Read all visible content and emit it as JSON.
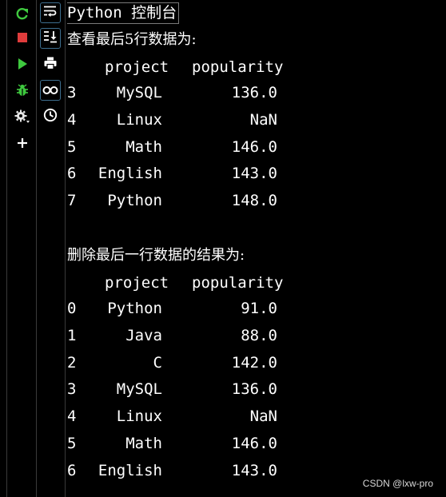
{
  "toolbar": {
    "rerun": "rerun-icon",
    "stop": "stop-icon",
    "run": "run-icon",
    "debug": "bug-icon",
    "settings": "gear-icon",
    "add": "plus-icon"
  },
  "side_toolbar": {
    "soft_wrap": "soft-wrap-icon",
    "scroll_to_end": "scroll-to-end-icon",
    "print": "print-icon",
    "show_variables": "glasses-icon",
    "history": "clock-icon"
  },
  "console": {
    "title": "Python 控制台",
    "block1": {
      "heading": "查看最后5行数据为:",
      "header": {
        "project": "project",
        "popularity": "popularity"
      },
      "rows": [
        {
          "idx": "3",
          "project": "MySQL",
          "popularity": "136.0"
        },
        {
          "idx": "4",
          "project": "Linux",
          "popularity": "NaN"
        },
        {
          "idx": "5",
          "project": "Math",
          "popularity": "146.0"
        },
        {
          "idx": "6",
          "project": "English",
          "popularity": "143.0"
        },
        {
          "idx": "7",
          "project": "Python",
          "popularity": "148.0"
        }
      ]
    },
    "block2": {
      "heading": "删除最后一行数据的结果为:",
      "header": {
        "project": "project",
        "popularity": "popularity"
      },
      "rows": [
        {
          "idx": "0",
          "project": "Python",
          "popularity": "91.0"
        },
        {
          "idx": "1",
          "project": "Java",
          "popularity": "88.0"
        },
        {
          "idx": "2",
          "project": "C",
          "popularity": "142.0"
        },
        {
          "idx": "3",
          "project": "MySQL",
          "popularity": "136.0"
        },
        {
          "idx": "4",
          "project": "Linux",
          "popularity": "NaN"
        },
        {
          "idx": "5",
          "project": "Math",
          "popularity": "146.0"
        },
        {
          "idx": "6",
          "project": "English",
          "popularity": "143.0"
        }
      ]
    }
  },
  "watermark": "CSDN @lxw-pro",
  "colors": {
    "background": "#000000",
    "text": "#ffffff",
    "rerun_green": "#3fc93f",
    "stop_red": "#e03c3c",
    "run_green": "#3fc93f",
    "debug_green": "#3fc93f",
    "toolbar_box": "#3d6e8f"
  }
}
